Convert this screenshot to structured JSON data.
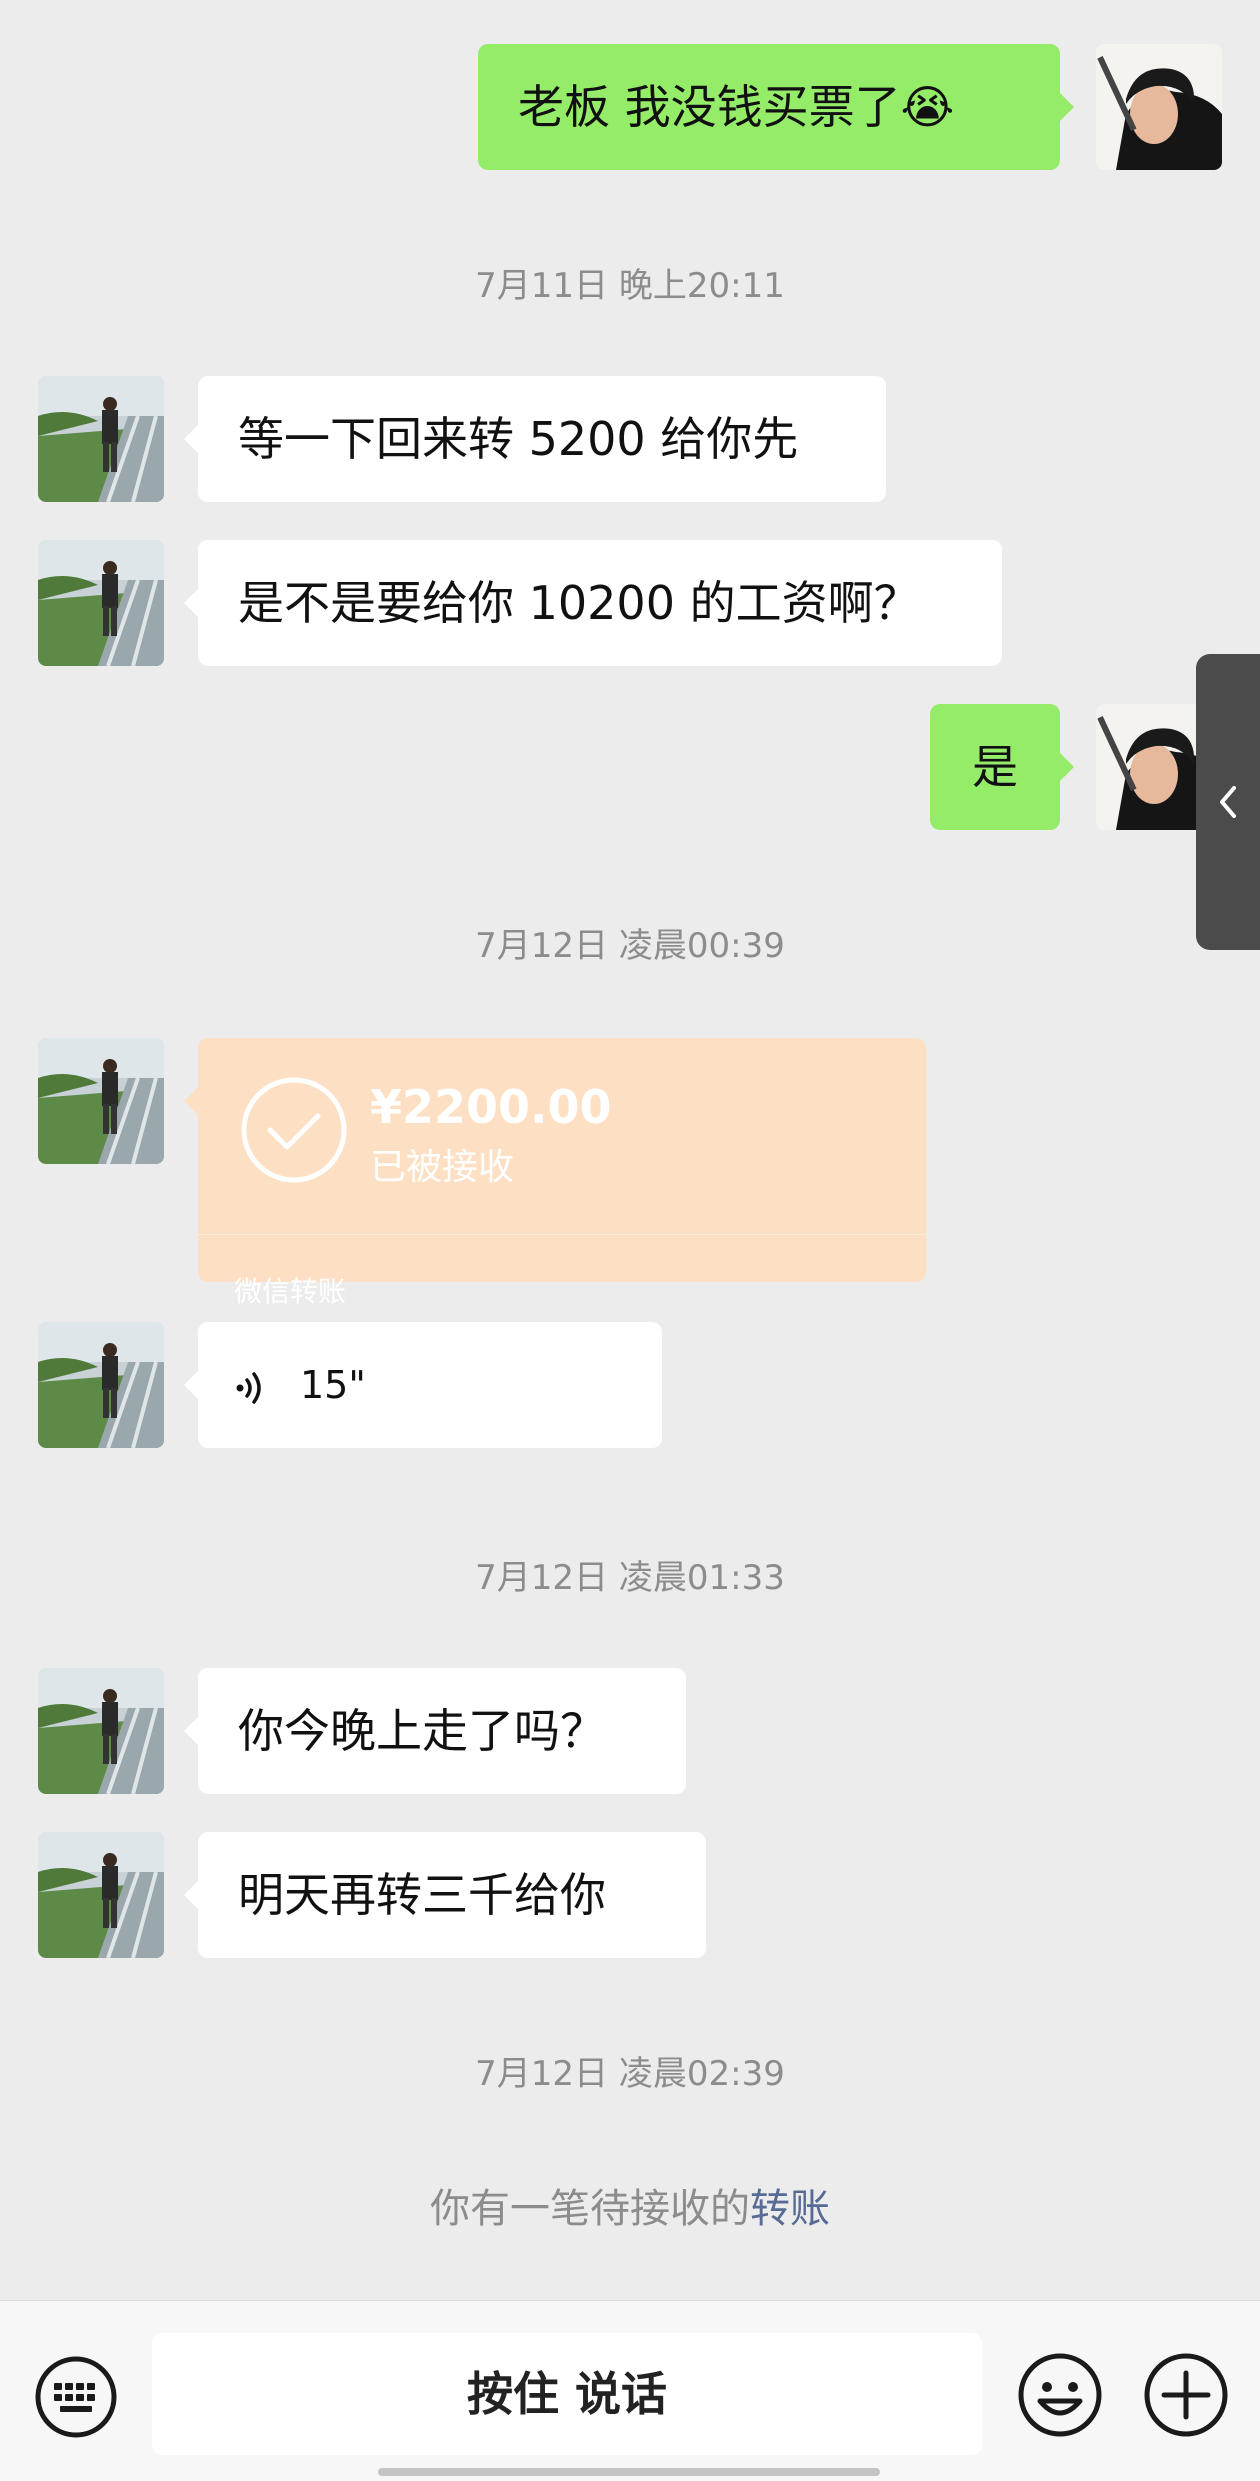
{
  "messages": [
    {
      "text": "老板  我没钱买票了😭"
    },
    {
      "text": "7月11日 晚上20:11"
    },
    {
      "text": "等一下回来转 5200 给你先"
    },
    {
      "text": "是不是要给你 10200 的工资啊？"
    },
    {
      "text": "是"
    },
    {
      "text": "7月12日 凌晨00:39"
    },
    {
      "amount": "¥2200.00",
      "status": "已被接收",
      "label": "微信转账"
    },
    {
      "duration": "15\""
    },
    {
      "text": "7月12日 凌晨01:33"
    },
    {
      "text": "你今晚上走了吗？"
    },
    {
      "text": "明天再转三千给你"
    },
    {
      "text": "7月12日 凌晨02:39"
    }
  ],
  "notice": {
    "prefix": "你有一笔待接收的",
    "link": "转账"
  },
  "input_bar": {
    "talk_label": "按住 说话"
  },
  "icons": {
    "keyboard": "keyboard-icon",
    "emoji": "emoji-icon",
    "plus": "plus-icon",
    "voice": "voice-wave-icon",
    "check": "check-circle-icon",
    "side_tab": "chevron-left-icon"
  },
  "colors": {
    "outgoing_bubble": "#95ec69",
    "incoming_bubble": "#ffffff",
    "transfer_bubble": "#fde0c4",
    "link": "#576b95",
    "background": "#ececec"
  }
}
